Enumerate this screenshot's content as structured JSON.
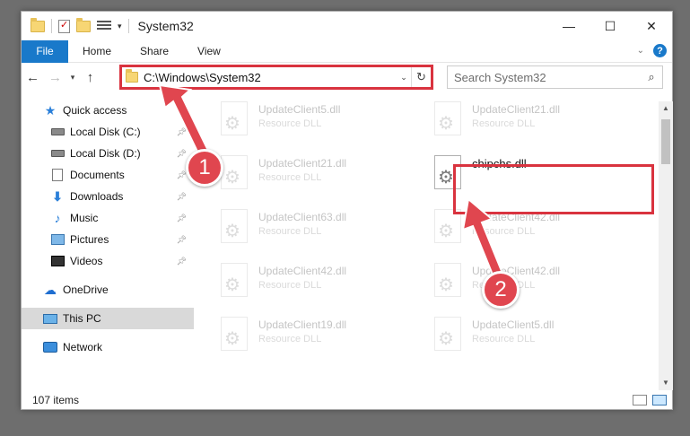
{
  "window": {
    "title": "System32"
  },
  "ribbon": {
    "tabs": [
      "File",
      "Home",
      "Share",
      "View"
    ]
  },
  "address": {
    "path": "C:\\Windows\\System32"
  },
  "search": {
    "placeholder": "Search System32"
  },
  "sidebar": {
    "items": [
      {
        "label": "Quick access",
        "icon": "star-icon",
        "pinned": false
      },
      {
        "label": "Local Disk (C:)",
        "icon": "drive-icon",
        "pinned": true
      },
      {
        "label": "Local Disk (D:)",
        "icon": "drive-icon",
        "pinned": true
      },
      {
        "label": "Documents",
        "icon": "documents-icon",
        "pinned": true
      },
      {
        "label": "Downloads",
        "icon": "downloads-icon",
        "pinned": true
      },
      {
        "label": "Music",
        "icon": "music-icon",
        "pinned": true
      },
      {
        "label": "Pictures",
        "icon": "pictures-icon",
        "pinned": true
      },
      {
        "label": "Videos",
        "icon": "videos-icon",
        "pinned": true
      },
      {
        "label": "OneDrive",
        "icon": "onedrive-icon",
        "pinned": false
      },
      {
        "label": "This PC",
        "icon": "this-pc-icon",
        "pinned": false,
        "selected": true
      },
      {
        "label": "Network",
        "icon": "network-icon",
        "pinned": false
      }
    ]
  },
  "files": [
    {
      "name": "UpdateClient5.dll",
      "type": "Resource DLL"
    },
    {
      "name": "UpdateClient21.dll",
      "type": "Resource DLL"
    },
    {
      "name": "UpdateClient21.dll",
      "type": "Resource DLL"
    },
    {
      "name": "chipchs.dll",
      "type": ""
    },
    {
      "name": "UpdateClient63.dll",
      "type": "Resource DLL"
    },
    {
      "name": "UpdateClient42.dll",
      "type": "Resource DLL"
    },
    {
      "name": "UpdateClient42.dll",
      "type": "Resource DLL"
    },
    {
      "name": "UpdateClient42.dll",
      "type": "Resource DLL"
    },
    {
      "name": "UpdateClient19.dll",
      "type": "Resource DLL"
    },
    {
      "name": "UpdateClient5.dll",
      "type": "Resource DLL"
    }
  ],
  "status": {
    "count": "107 items"
  },
  "annotations": {
    "badge1": "1",
    "badge2": "2",
    "color": "#e0464f"
  }
}
